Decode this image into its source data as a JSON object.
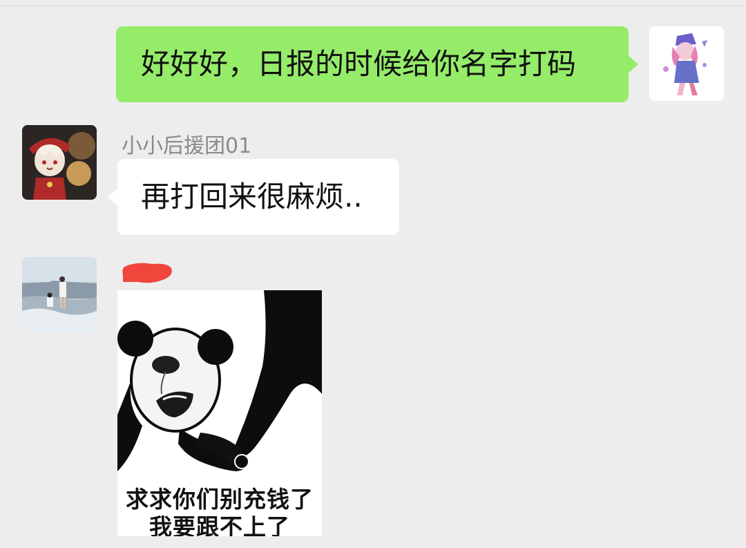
{
  "messages": [
    {
      "direction": "outgoing",
      "type": "text",
      "text": "好好好，日报的时候给你名字打码"
    },
    {
      "direction": "incoming",
      "type": "text",
      "sender": "小小后援团01",
      "text": "再打回来很麻烦.."
    },
    {
      "direction": "incoming",
      "type": "sticker",
      "sender_redacted": true,
      "caption_line1": "求求你们别充钱了",
      "caption_line2": "我要跟不上了"
    }
  ],
  "avatars": {
    "self": "anime-girl-avatar",
    "sender1": "anime-character-avatar",
    "sender2": "beach-photo-avatar"
  },
  "colors": {
    "background": "#ededed",
    "outgoing_bubble": "#95ec69",
    "incoming_bubble": "#ffffff",
    "sender_name": "#8a8a8a",
    "redaction": "#f0463c"
  }
}
